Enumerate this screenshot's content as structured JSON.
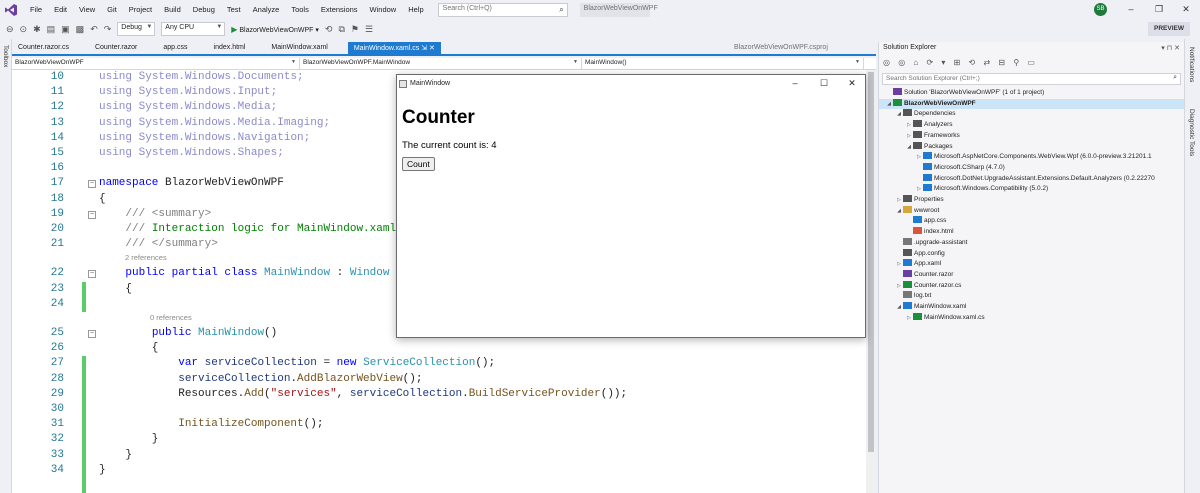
{
  "menubar": {
    "items": [
      "File",
      "Edit",
      "View",
      "Git",
      "Project",
      "Build",
      "Debug",
      "Test",
      "Analyze",
      "Tools",
      "Extensions",
      "Window",
      "Help"
    ],
    "search_placeholder": "Search (Ctrl+Q)",
    "solution_title": "BlazorWebViewOnWPF",
    "avatar": "SB"
  },
  "toolbar": {
    "config": "Debug",
    "platform": "Any CPU",
    "run_target": "BlazorWebViewOnWPF",
    "preview": "PREVIEW"
  },
  "leftstrip": {
    "toolbox": "Toolbox"
  },
  "rightstrip": {
    "notifications": "Notifications",
    "diagnostic": "Diagnostic Tools"
  },
  "tabs": [
    "Counter.razor.cs",
    "Counter.razor",
    "app.css",
    "index.html",
    "MainWindow.xaml",
    "MainWindow.xaml.cs"
  ],
  "active_tab": "MainWindow.xaml.cs",
  "tab_pin": "⇲ ✕",
  "project_tab": "BlazorWebViewOnWPF.csproj",
  "navbar": {
    "project": "BlazorWebViewOnWPF",
    "class": "BlazorWebViewOnWPF.MainWindow",
    "member": "MainWindow()"
  },
  "code": {
    "lines": [
      {
        "n": "10",
        "tokens": [
          [
            "us",
            "using"
          ],
          [
            "us",
            " System.Windows.Documents;"
          ]
        ]
      },
      {
        "n": "11",
        "tokens": [
          [
            "us",
            "using"
          ],
          [
            "us",
            " System.Windows.Input;"
          ]
        ]
      },
      {
        "n": "12",
        "tokens": [
          [
            "us",
            "using"
          ],
          [
            "us",
            " System.Windows.Media;"
          ]
        ]
      },
      {
        "n": "13",
        "tokens": [
          [
            "us",
            "using"
          ],
          [
            "us",
            " System.Windows.Media.Imaging;"
          ]
        ]
      },
      {
        "n": "14",
        "tokens": [
          [
            "us",
            "using"
          ],
          [
            "us",
            " System.Windows.Navigation;"
          ]
        ]
      },
      {
        "n": "15",
        "tokens": [
          [
            "us",
            "using"
          ],
          [
            "us",
            " System.Windows.Shapes;"
          ]
        ]
      },
      {
        "n": "16",
        "tokens": []
      },
      {
        "n": "17",
        "tokens": [
          [
            "kw",
            "namespace"
          ],
          [
            "",
            " BlazorWebViewOnWPF"
          ]
        ]
      },
      {
        "n": "18",
        "tokens": [
          [
            "",
            "{"
          ]
        ]
      },
      {
        "n": "19",
        "tokens": [
          [
            "cmg",
            "    /// <summary>"
          ]
        ]
      },
      {
        "n": "20",
        "tokens": [
          [
            "cmg",
            "    /// "
          ],
          [
            "cm",
            "Interaction logic for MainWindow.xaml"
          ]
        ]
      },
      {
        "n": "21",
        "tokens": [
          [
            "cmg",
            "    /// </summary>"
          ]
        ]
      },
      {
        "n": "22",
        "tokens": [
          [
            "",
            "    "
          ],
          [
            "kw",
            "public partial class"
          ],
          [
            "",
            " "
          ],
          [
            "ty",
            "MainWindow"
          ],
          [
            "",
            " : "
          ],
          [
            "ty",
            "Window"
          ]
        ]
      },
      {
        "n": "23",
        "tokens": [
          [
            "",
            "    {"
          ]
        ]
      },
      {
        "n": "24",
        "tokens": []
      },
      {
        "n": "25",
        "tokens": [
          [
            "",
            "        "
          ],
          [
            "kw",
            "public"
          ],
          [
            "",
            " "
          ],
          [
            "ty",
            "MainWindow"
          ],
          [
            "",
            "()"
          ]
        ]
      },
      {
        "n": "26",
        "tokens": [
          [
            "",
            "        {"
          ]
        ]
      },
      {
        "n": "27",
        "tokens": [
          [
            "",
            "            "
          ],
          [
            "kw",
            "var"
          ],
          [
            "",
            " "
          ],
          [
            "nm",
            "serviceCollection"
          ],
          [
            "",
            " = "
          ],
          [
            "kw",
            "new"
          ],
          [
            "",
            " "
          ],
          [
            "ty",
            "ServiceCollection"
          ],
          [
            "",
            "();"
          ]
        ]
      },
      {
        "n": "28",
        "tokens": [
          [
            "",
            "            "
          ],
          [
            "nm",
            "serviceCollection"
          ],
          [
            "",
            "."
          ],
          [
            "fn",
            "AddBlazorWebView"
          ],
          [
            "",
            "();"
          ]
        ]
      },
      {
        "n": "29",
        "tokens": [
          [
            "",
            "            Resources."
          ],
          [
            "fn",
            "Add"
          ],
          [
            "",
            "("
          ],
          [
            "st",
            "\"services\""
          ],
          [
            "",
            ", "
          ],
          [
            "nm",
            "serviceCollection"
          ],
          [
            "",
            "."
          ],
          [
            "fn",
            "BuildServiceProvider"
          ],
          [
            "",
            "());"
          ]
        ]
      },
      {
        "n": "30",
        "tokens": []
      },
      {
        "n": "31",
        "tokens": [
          [
            "",
            "            "
          ],
          [
            "fn",
            "InitializeComponent"
          ],
          [
            "",
            "();"
          ]
        ]
      },
      {
        "n": "32",
        "tokens": [
          [
            "",
            "        }"
          ]
        ]
      },
      {
        "n": "33",
        "tokens": [
          [
            "",
            "    }"
          ]
        ]
      },
      {
        "n": "34",
        "tokens": [
          [
            "",
            "}"
          ]
        ]
      }
    ],
    "refs": {
      "class_refs": "2 references",
      "ctor_refs": "0 references"
    }
  },
  "popup": {
    "title": "MainWindow",
    "heading": "Counter",
    "count_text": "The current count is: 4",
    "button": "Count"
  },
  "solution_explorer": {
    "title": "Solution Explorer",
    "search_placeholder": "Search Solution Explorer (Ctrl+;)",
    "items": [
      {
        "label": "Solution 'BlazorWebViewOnWPF' (1 of 1 project)",
        "depth": 0,
        "tw": "",
        "icon": "solution-icon"
      },
      {
        "label": "BlazorWebViewOnWPF",
        "depth": 0,
        "tw": "◢",
        "icon": "csproj-icon",
        "bold": true,
        "sel": true
      },
      {
        "label": "Dependencies",
        "depth": 1,
        "tw": "◢",
        "icon": "dependencies-icon"
      },
      {
        "label": "Analyzers",
        "depth": 2,
        "tw": "▷",
        "icon": "analyzers-icon"
      },
      {
        "label": "Frameworks",
        "depth": 2,
        "tw": "▷",
        "icon": "frameworks-icon"
      },
      {
        "label": "Packages",
        "depth": 2,
        "tw": "◢",
        "icon": "packages-icon"
      },
      {
        "label": "Microsoft.AspNetCore.Components.WebView.Wpf (6.0.0-preview.3.21201.1",
        "depth": 3,
        "tw": "▷",
        "icon": "package-icon"
      },
      {
        "label": "Microsoft.CSharp (4.7.0)",
        "depth": 3,
        "tw": "",
        "icon": "package-icon"
      },
      {
        "label": "Microsoft.DotNet.UpgradeAssistant.Extensions.Default.Analyzers (0.2.22270",
        "depth": 3,
        "tw": "",
        "icon": "package-icon"
      },
      {
        "label": "Microsoft.Windows.Compatibility (5.0.2)",
        "depth": 3,
        "tw": "▷",
        "icon": "package-icon"
      },
      {
        "label": "Properties",
        "depth": 1,
        "tw": "▷",
        "icon": "properties-icon"
      },
      {
        "label": "wwwroot",
        "depth": 1,
        "tw": "◢",
        "icon": "folder-icon"
      },
      {
        "label": "app.css",
        "depth": 2,
        "tw": "",
        "icon": "css-file-icon"
      },
      {
        "label": "index.html",
        "depth": 2,
        "tw": "",
        "icon": "html-file-icon"
      },
      {
        "label": ".upgrade-assistant",
        "depth": 1,
        "tw": "",
        "icon": "file-icon"
      },
      {
        "label": "App.config",
        "depth": 1,
        "tw": "",
        "icon": "config-file-icon"
      },
      {
        "label": "App.xaml",
        "depth": 1,
        "tw": "▷",
        "icon": "xaml-file-icon"
      },
      {
        "label": "Counter.razor",
        "depth": 1,
        "tw": "",
        "icon": "razor-file-icon"
      },
      {
        "label": "Counter.razor.cs",
        "depth": 1,
        "tw": "▷",
        "icon": "cs-file-icon"
      },
      {
        "label": "log.txt",
        "depth": 1,
        "tw": "",
        "icon": "text-file-icon"
      },
      {
        "label": "MainWindow.xaml",
        "depth": 1,
        "tw": "◢",
        "icon": "xaml-file-icon"
      },
      {
        "label": "MainWindow.xaml.cs",
        "depth": 2,
        "tw": "▷",
        "icon": "cs-file-icon"
      }
    ]
  },
  "colors": {
    "accent": "#1e7bd0",
    "change_bar": "#5ecb6a",
    "avatar": "#1f7a3d"
  }
}
